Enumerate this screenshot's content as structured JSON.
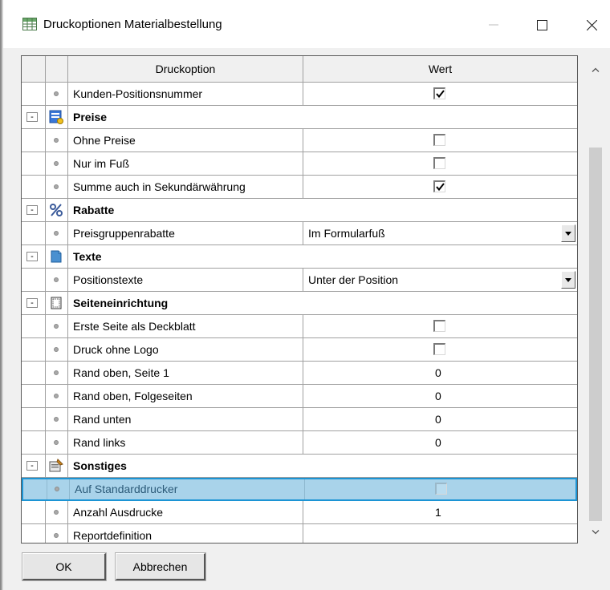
{
  "window": {
    "title": "Druckoptionen Materialbestellung",
    "app_icon": "grid-table-icon",
    "controls": [
      "minimize-icon",
      "maximize-icon",
      "close-icon"
    ]
  },
  "grid": {
    "columns": {
      "option": "Druckoption",
      "value": "Wert"
    },
    "rows": [
      {
        "kind": "item",
        "label": "Kunden-Positionsnummer",
        "type": "checkbox",
        "checked": true
      },
      {
        "kind": "category",
        "label": "Preise",
        "icon": "price-list-icon"
      },
      {
        "kind": "item",
        "label": "Ohne Preise",
        "type": "checkbox",
        "checked": false
      },
      {
        "kind": "item",
        "label": "Nur im Fuß",
        "type": "checkbox",
        "checked": false
      },
      {
        "kind": "item",
        "label": "Summe auch in Sekundärwährung",
        "type": "checkbox",
        "checked": true
      },
      {
        "kind": "category",
        "label": "Rabatte",
        "icon": "percent-icon"
      },
      {
        "kind": "item",
        "label": "Preisgruppenrabatte",
        "type": "dropdown",
        "value": "Im Formularfuß"
      },
      {
        "kind": "category",
        "label": "Texte",
        "icon": "document-text-icon"
      },
      {
        "kind": "item",
        "label": "Positionstexte",
        "type": "dropdown",
        "value": "Unter der Position"
      },
      {
        "kind": "category",
        "label": "Seiteneinrichtung",
        "icon": "page-setup-icon"
      },
      {
        "kind": "item",
        "label": "Erste Seite als Deckblatt",
        "type": "checkbox",
        "checked": false
      },
      {
        "kind": "item",
        "label": "Druck ohne Logo",
        "type": "checkbox",
        "checked": false
      },
      {
        "kind": "item",
        "label": "Rand oben, Seite 1",
        "type": "number",
        "value": "0"
      },
      {
        "kind": "item",
        "label": "Rand oben, Folgeseiten",
        "type": "number",
        "value": "0"
      },
      {
        "kind": "item",
        "label": "Rand unten",
        "type": "number",
        "value": "0"
      },
      {
        "kind": "item",
        "label": "Rand links",
        "type": "number",
        "value": "0"
      },
      {
        "kind": "category",
        "label": "Sonstiges",
        "icon": "settings-form-icon"
      },
      {
        "kind": "item",
        "label": "Auf Standarddrucker",
        "type": "checkbox",
        "checked": false,
        "selected": true
      },
      {
        "kind": "item",
        "label": "Anzahl Ausdrucke",
        "type": "number",
        "value": "1"
      },
      {
        "kind": "item",
        "label": "Reportdefinition",
        "type": "text",
        "value": ""
      }
    ],
    "collapse_symbol": "-"
  },
  "buttons": {
    "ok": "OK",
    "cancel": "Abbrechen"
  },
  "colors": {
    "selection_fill": "#a9d3ea",
    "selection_border": "#1c94d4"
  }
}
